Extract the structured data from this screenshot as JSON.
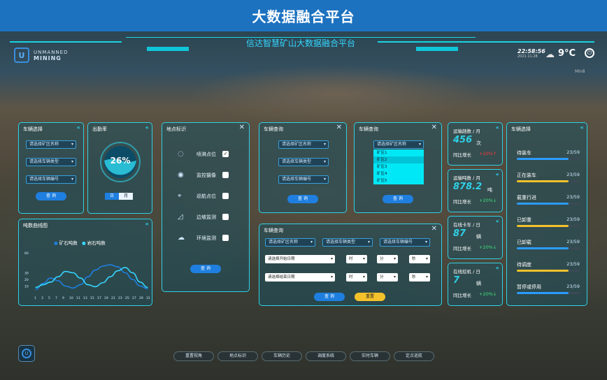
{
  "page_title": "大数据融合平台",
  "header": {
    "subtitle": "信达智慧矿山大数据融合平台",
    "logo_line1": "UNMANNED",
    "logo_line2": "MINING",
    "logo_glyph": "U",
    "time": "22:58:56",
    "date": "2021.11.28",
    "temperature": "9°C",
    "weather_icon": "cloud-icon",
    "power_icon": "power-icon",
    "small_label": "Min8"
  },
  "vehicle_select": {
    "title": "车辆选择",
    "select1": "请选择矿区名称",
    "select2": "请选择车辆类型",
    "select3": "请选择车辆编号",
    "query": "查 询"
  },
  "attendance": {
    "title": "出勤率",
    "percent": "26%",
    "percent_value": 26,
    "tab_day": "日",
    "tab_month": "月"
  },
  "tonnage_chart": {
    "title": "吨数曲线图",
    "chart_data": {
      "type": "line",
      "ylim": [
        0,
        60
      ],
      "yticks": [
        "60",
        "30",
        "20",
        "10"
      ],
      "xticks": [
        "1",
        "3",
        "5",
        "7",
        "9",
        "10",
        "11",
        "13",
        "15",
        "17",
        "19",
        "21",
        "23",
        "25",
        "27",
        "29",
        "31"
      ],
      "x": [
        1,
        3,
        5,
        7,
        9,
        11,
        13,
        15,
        17,
        19,
        21,
        23,
        25,
        27,
        29,
        31
      ],
      "series": [
        {
          "name": "矿石吨数",
          "color": "#1f7fe0",
          "values": [
            5,
            14,
            22,
            18,
            10,
            7,
            12,
            24,
            34,
            40,
            42,
            39,
            30,
            20,
            10,
            6
          ]
        },
        {
          "name": "岩石吨数",
          "color": "#35d6ff",
          "values": [
            8,
            12,
            16,
            24,
            32,
            30,
            22,
            12,
            9,
            15,
            24,
            33,
            38,
            30,
            16,
            8
          ]
        }
      ]
    }
  },
  "location_marks": {
    "title": "地点标识",
    "items": [
      {
        "icon": "spray-icon",
        "glyph": "◌",
        "label": "喷淋点位",
        "checked": true
      },
      {
        "icon": "camera-icon",
        "glyph": "◉",
        "label": "监控摄像",
        "checked": false
      },
      {
        "icon": "patrol-pin-icon",
        "glyph": "⌖",
        "label": "巡航点位",
        "checked": false
      },
      {
        "icon": "slope-icon",
        "glyph": "◿",
        "label": "边坡监测",
        "checked": false
      },
      {
        "icon": "env-cloud-icon",
        "glyph": "☁",
        "label": "环境监测",
        "checked": false
      }
    ],
    "query": "查 询"
  },
  "vehicle_query_a": {
    "title": "车辆查询",
    "select1": "请选择矿区名称",
    "select2": "请选择车辆类型",
    "select3": "请选择车辆编号",
    "query": "查 询"
  },
  "vehicle_query_b": {
    "title": "车辆查询",
    "select1": "请选择矿区名称",
    "options": [
      "矿区1",
      "矿区2",
      "矿区3",
      "矿区4",
      "矿区5"
    ],
    "query": "查 询"
  },
  "vehicle_query_c": {
    "title": "车辆查询",
    "select1": "请选择矿区名称",
    "select2": "请选择车辆类型",
    "select3": "请选择车辆编号",
    "start_date": "请选择开始日期",
    "end_date": "请选择结束日期",
    "hour": "时",
    "minute": "分",
    "second": "秒",
    "query": "查 询",
    "reset": "重置"
  },
  "stats": [
    {
      "title": "运输趟数 / 月",
      "value": "456",
      "unit": "次",
      "compare": "同比增长",
      "delta": "+20%",
      "dir": "up-red"
    },
    {
      "title": "运输吨数 / 月",
      "value": "878.2",
      "unit": "吨",
      "compare": "同比增长",
      "delta": "+20%",
      "dir": "down-green"
    },
    {
      "title": "在线卡车 / 日",
      "value": "87",
      "unit": "辆",
      "compare": "同比增长",
      "delta": "+20%",
      "dir": "down-green"
    },
    {
      "title": "在线挖机 / 日",
      "value": "7",
      "unit": "辆",
      "compare": "同比增长",
      "delta": "+20%",
      "dir": "down-green"
    }
  ],
  "vehicle_status": {
    "title": "车辆选择",
    "rows": [
      {
        "label": "待装车",
        "count": "23/59",
        "ratio": 0.39,
        "color": "#2b9cff"
      },
      {
        "label": "正在装车",
        "count": "23/59",
        "ratio": 0.39,
        "color": "#f3c12b"
      },
      {
        "label": "载重行进",
        "count": "23/59",
        "ratio": 0.39,
        "color": "#2b9cff"
      },
      {
        "label": "已卸重",
        "count": "23/59",
        "ratio": 0.39,
        "color": "#f3c12b"
      },
      {
        "label": "已卸载",
        "count": "23/59",
        "ratio": 0.39,
        "color": "#2b9cff"
      },
      {
        "label": "待调度",
        "count": "23/59",
        "ratio": 0.39,
        "color": "#f3c12b"
      },
      {
        "label": "暂停或停用",
        "count": "23/59",
        "ratio": 0.39,
        "color": "#2b9cff"
      }
    ]
  },
  "bottom_nav": [
    "重置视角",
    "地点标识",
    "车辆历史",
    "调度系统",
    "实时车辆",
    "定点巡航"
  ]
}
